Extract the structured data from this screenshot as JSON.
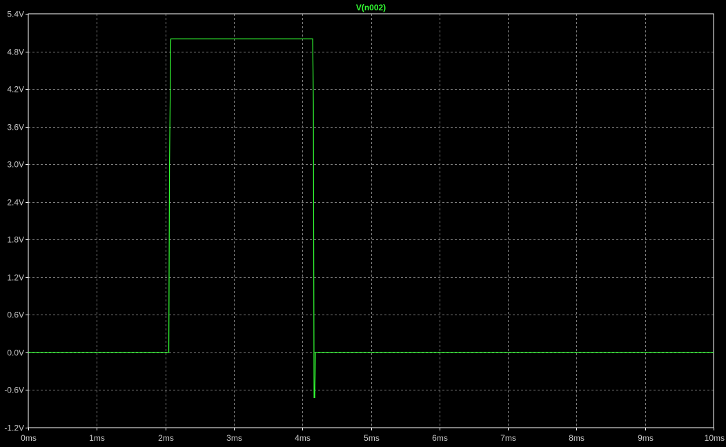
{
  "chart_data": {
    "type": "line",
    "title": "V(n002)",
    "xlabel": "",
    "ylabel": "",
    "x_unit": "ms",
    "y_unit": "V",
    "xlim": [
      0,
      10
    ],
    "ylim": [
      -1.2,
      5.4
    ],
    "x_ticks": [
      "0ms",
      "1ms",
      "2ms",
      "3ms",
      "4ms",
      "5ms",
      "6ms",
      "7ms",
      "8ms",
      "9ms",
      "10ms"
    ],
    "x_tick_values": [
      0,
      1,
      2,
      3,
      4,
      5,
      6,
      7,
      8,
      9,
      10
    ],
    "y_ticks": [
      "5.4V",
      "4.8V",
      "4.2V",
      "3.6V",
      "3.0V",
      "2.4V",
      "1.8V",
      "1.2V",
      "0.6V",
      "0.0V",
      "-0.6V",
      "-1.2V"
    ],
    "y_tick_values": [
      5.4,
      4.8,
      4.2,
      3.6,
      3.0,
      2.4,
      1.8,
      1.2,
      0.6,
      0.0,
      -0.6,
      -1.2
    ],
    "grid": true,
    "series": [
      {
        "name": "V(n002)",
        "color": "#33ff33",
        "x": [
          0,
          2.05,
          2.06,
          2.08,
          4.15,
          4.16,
          4.17,
          4.18,
          4.19,
          10
        ],
        "y": [
          0.0,
          0.0,
          3.0,
          5.0,
          5.0,
          3.95,
          -0.72,
          -0.72,
          0.0,
          0.0
        ]
      }
    ]
  },
  "colors": {
    "background": "#000000",
    "frame": "#ffffff",
    "grid": "#7f7f7f",
    "tick_text": "#c8c8c8",
    "trace": "#33ff33"
  }
}
